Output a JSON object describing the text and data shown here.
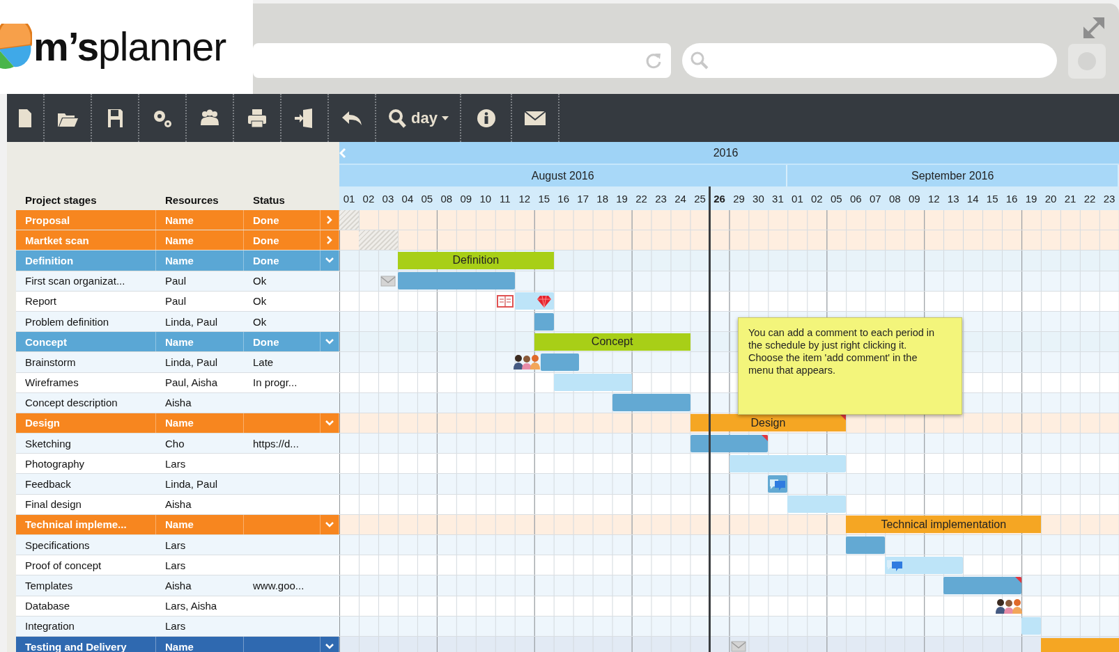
{
  "logo": {
    "text": "**m’s**planner"
  },
  "toolbar": {
    "zoom_label": "day"
  },
  "timeline": {
    "year": "2016",
    "months": [
      {
        "label": "August 2016",
        "days": [
          {
            "label": "01",
            "today": false
          },
          {
            "label": "02",
            "today": false
          },
          {
            "label": "03",
            "today": false
          },
          {
            "label": "04",
            "today": false
          },
          {
            "label": "05",
            "today": false
          },
          {
            "label": "08",
            "today": false
          },
          {
            "label": "09",
            "today": false
          },
          {
            "label": "10",
            "today": false
          },
          {
            "label": "11",
            "today": false
          },
          {
            "label": "12",
            "today": false
          },
          {
            "label": "15",
            "today": false
          },
          {
            "label": "16",
            "today": false
          },
          {
            "label": "17",
            "today": false
          },
          {
            "label": "18",
            "today": false
          },
          {
            "label": "19",
            "today": false
          },
          {
            "label": "22",
            "today": false
          },
          {
            "label": "23",
            "today": false
          },
          {
            "label": "24",
            "today": false
          },
          {
            "label": "25",
            "today": false
          },
          {
            "label": "26",
            "today": true
          },
          {
            "label": "29",
            "today": false
          },
          {
            "label": "30",
            "today": false
          },
          {
            "label": "31",
            "today": false
          }
        ]
      },
      {
        "label": "September 2016",
        "days": [
          {
            "label": "01",
            "today": false
          },
          {
            "label": "02",
            "today": false
          },
          {
            "label": "05",
            "today": false
          },
          {
            "label": "06",
            "today": false
          },
          {
            "label": "07",
            "today": false
          },
          {
            "label": "08",
            "today": false
          },
          {
            "label": "09",
            "today": false
          },
          {
            "label": "12",
            "today": false
          },
          {
            "label": "13",
            "today": false
          },
          {
            "label": "14",
            "today": false
          },
          {
            "label": "15",
            "today": false
          },
          {
            "label": "16",
            "today": false
          },
          {
            "label": "19",
            "today": false
          },
          {
            "label": "20",
            "today": false
          },
          {
            "label": "21",
            "today": false
          },
          {
            "label": "22",
            "today": false
          },
          {
            "label": "23",
            "today": false
          }
        ]
      }
    ]
  },
  "columns": [
    "Project stages",
    "Resources",
    "Status"
  ],
  "rows": [
    {
      "kind": "group",
      "name": "Proposal",
      "resources": "Name",
      "status": "Done",
      "color": "#f7861f",
      "expanded": false,
      "bars": [
        {
          "kind": "hatched"
        }
      ]
    },
    {
      "kind": "group",
      "name": "Martket scan",
      "resources": "Name",
      "status": "Done",
      "color": "#f7861f",
      "expanded": false,
      "bars": [
        {
          "kind": "hatched"
        }
      ]
    },
    {
      "kind": "group",
      "name": "Definition",
      "resources": "Name",
      "status": "Done",
      "color": "#5aa7d5",
      "expanded": true,
      "bars": [
        {
          "kind": "summary",
          "label": "Definition",
          "color": "#a8cf17"
        }
      ]
    },
    {
      "kind": "task",
      "name": "First scan organizat...",
      "resources": "Paul",
      "status": "Ok",
      "bars": [
        {
          "kind": "task",
          "color": "#63a9d3"
        }
      ],
      "markers": [
        {
          "kind": "mail"
        }
      ]
    },
    {
      "kind": "task",
      "name": "Report",
      "resources": "Paul",
      "status": "Ok",
      "bars": [
        {
          "kind": "task",
          "color": "#bde4f8"
        }
      ],
      "markers": [
        {
          "kind": "book"
        },
        {
          "kind": "gem"
        }
      ]
    },
    {
      "kind": "task",
      "name": "Problem definition",
      "resources": "Linda, Paul",
      "status": "Ok",
      "bars": [
        {
          "kind": "task",
          "color": "#63a9d3"
        }
      ]
    },
    {
      "kind": "group",
      "name": "Concept",
      "resources": "Name",
      "status": "Done",
      "color": "#5aa7d5",
      "expanded": true,
      "bars": [
        {
          "kind": "summary",
          "label": "Concept",
          "color": "#a8cf17"
        }
      ]
    },
    {
      "kind": "task",
      "name": "Brainstorm",
      "resources": "Linda, Paul",
      "status": "Late",
      "bars": [
        {
          "kind": "task",
          "color": "#63a9d3"
        }
      ],
      "markers": [
        {
          "kind": "people"
        }
      ]
    },
    {
      "kind": "task",
      "name": "Wireframes",
      "resources": "Paul, Aisha",
      "status": "In progr...",
      "bars": [
        {
          "kind": "task",
          "color": "#bde4f8"
        }
      ]
    },
    {
      "kind": "task",
      "name": "Concept description",
      "resources": "Aisha",
      "bars": [
        {
          "kind": "task",
          "color": "#63a9d3"
        }
      ]
    },
    {
      "kind": "group",
      "name": "Design",
      "resources": "Name",
      "color": "#f7861f",
      "expanded": true,
      "bars": [
        {
          "kind": "summary",
          "label": "Design",
          "color": "#f5a623",
          "flag": true
        }
      ]
    },
    {
      "kind": "task",
      "name": "Sketching",
      "resources": "Cho",
      "status": "https://d...",
      "bars": [
        {
          "kind": "task",
          "color": "#63a9d3",
          "flag": true
        }
      ]
    },
    {
      "kind": "task",
      "name": "Photography",
      "resources": "Lars",
      "bars": [
        {
          "kind": "task",
          "color": "#bde4f8"
        }
      ]
    },
    {
      "kind": "task",
      "name": "Feedback",
      "resources": "Linda, Paul",
      "bars": [
        {
          "kind": "task",
          "color": "#63a9d3"
        }
      ],
      "markers": [
        {
          "kind": "comment"
        }
      ]
    },
    {
      "kind": "task",
      "name": "Final design",
      "resources": "Aisha",
      "bars": [
        {
          "kind": "task",
          "color": "#bde4f8"
        }
      ]
    },
    {
      "kind": "group",
      "name": "Technical impleme...",
      "resources": "Name",
      "color": "#f7861f",
      "expanded": true,
      "bars": [
        {
          "kind": "summary",
          "label": "Technical implementation",
          "color": "#f5a623"
        }
      ]
    },
    {
      "kind": "task",
      "name": "Specifications",
      "resources": "Lars",
      "bars": [
        {
          "kind": "task",
          "color": "#63a9d3"
        }
      ]
    },
    {
      "kind": "task",
      "name": "Proof of concept",
      "resources": "Lars",
      "bars": [
        {
          "kind": "task",
          "color": "#bde4f8"
        }
      ],
      "markers": [
        {
          "kind": "comment"
        }
      ]
    },
    {
      "kind": "task",
      "name": "Templates",
      "resources": "Aisha",
      "status": "www.goo...",
      "bars": [
        {
          "kind": "task",
          "color": "#63a9d3",
          "flag": true
        }
      ]
    },
    {
      "kind": "task",
      "name": "Database",
      "resources": "Lars, Aisha",
      "markers": [
        {
          "kind": "people"
        }
      ]
    },
    {
      "kind": "task",
      "name": "Integration",
      "resources": "Lars",
      "bars": [
        {
          "kind": "task",
          "color": "#bde4f8"
        }
      ]
    },
    {
      "kind": "group",
      "name": "Testing and Delivery",
      "resources": "Name",
      "color": "#2f69b0",
      "expanded": true,
      "bars": [
        {
          "kind": "summary",
          "color": "#f5a623"
        }
      ],
      "markers": [
        {
          "kind": "mail"
        }
      ]
    }
  ],
  "comment_note": "You can add a comment to each period in the schedule by just right clicking it. Choose the item 'add comment' in the menu that appears."
}
